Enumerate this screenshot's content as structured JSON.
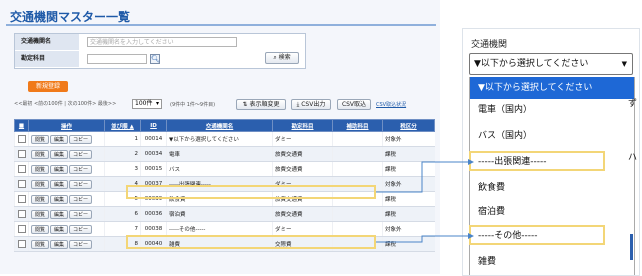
{
  "page": {
    "title": "交通機関マスター一覧",
    "search": {
      "name_label": "交通機関名",
      "name_placeholder": "交通機関名を入力してください",
      "subject_label": "勘定科目",
      "subject_value": "",
      "search_button": "検索"
    },
    "new_button": "新規登録",
    "pager": {
      "text": "<<最初 <前の100件 | 次の100件> 最後>>",
      "per_page": "100件",
      "info": "(9件中 1件〜9件目)",
      "order_button": "表示順変更",
      "csv_export": "CSV出力",
      "csv_import": "CSV取込",
      "csv_status": "CSV取込状況"
    },
    "table": {
      "headers": [
        "操作",
        "並び順 ▲",
        "ID",
        "交通機関名",
        "勘定科目",
        "補助科目",
        "税区分"
      ],
      "action_buttons": [
        "閲覧",
        "編集",
        "コピー"
      ],
      "rows": [
        {
          "order": "1",
          "id": "00014",
          "name": "▼以下から選択してください",
          "subject": "ダミー",
          "sub": "",
          "tax": "対象外"
        },
        {
          "order": "2",
          "id": "00034",
          "name": "電車",
          "subject": "旅費交通費",
          "sub": "",
          "tax": "課税"
        },
        {
          "order": "3",
          "id": "00015",
          "name": "バス",
          "subject": "旅費交通費",
          "sub": "",
          "tax": "課税"
        },
        {
          "order": "4",
          "id": "00037",
          "name": "-----出張関連-----",
          "subject": "ダミー",
          "sub": "",
          "tax": "対象外"
        },
        {
          "order": "5",
          "id": "00039",
          "name": "飲食費",
          "subject": "旅費交通費",
          "sub": "",
          "tax": "課税"
        },
        {
          "order": "6",
          "id": "00036",
          "name": "宿泊費",
          "subject": "旅費交通費",
          "sub": "",
          "tax": "課税"
        },
        {
          "order": "7",
          "id": "00038",
          "name": "-----その他-----",
          "subject": "ダミー",
          "sub": "",
          "tax": "対象外"
        },
        {
          "order": "8",
          "id": "00040",
          "name": "雑費",
          "subject": "交際費",
          "sub": "",
          "tax": "課税"
        }
      ]
    }
  },
  "dropdown": {
    "label": "交通機関",
    "selected": "▼以下から選択してください",
    "options": [
      "▼以下から選択してください",
      "電車（国内）",
      "バス（国内）",
      "-----出張関連-----",
      "飲食費",
      "宿泊費",
      "-----その他-----",
      "雑費"
    ],
    "peek_text": [
      "ず",
      "ハ"
    ]
  },
  "colors": {
    "header_blue": "#2b5fae",
    "title_blue": "#1f5aa8",
    "new_button_orange": "#f07a1a",
    "highlight_yellow": "#f3d677",
    "selected_option_blue": "#1e68d6"
  }
}
